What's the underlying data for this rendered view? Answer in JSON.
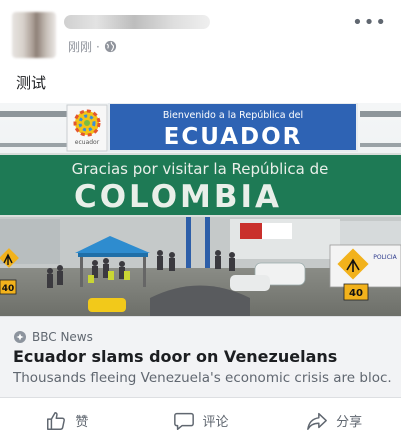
{
  "post": {
    "time": "刚刚",
    "separator": "·",
    "text": "测试",
    "more_icon": "more-horizontal-icon",
    "privacy_icon": "globe-icon"
  },
  "sign": {
    "welcome_line": "Bienvenido a la República del",
    "country_top": "ECUADOR",
    "emblem_label": "ecuador",
    "thanks_line": "Gracias por visitar la República de",
    "country_bottom": "COLOMBIA",
    "speed_left": "40",
    "speed_right": "40",
    "side_label": "POLICIA"
  },
  "link": {
    "source": "BBC News",
    "title": "Ecuador slams door on Venezuelans",
    "description": "Thousands fleeing Venezuela's economic crisis are bloc..."
  },
  "actions": {
    "like": "赞",
    "comment": "评论",
    "share": "分享"
  },
  "colors": {
    "sign_blue": "#2e63b4",
    "sign_green": "#1e7a55",
    "link_bg": "#f2f3f5",
    "muted_text": "#606770"
  }
}
